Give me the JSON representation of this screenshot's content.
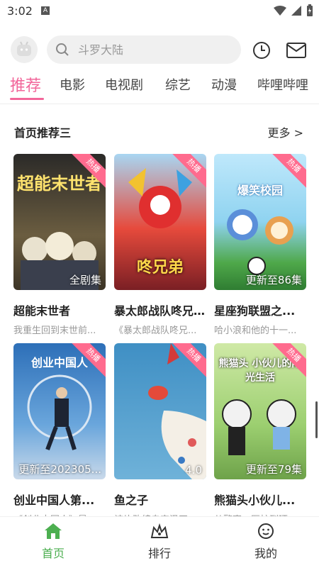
{
  "status": {
    "time": "3:02",
    "notif_letter": "A"
  },
  "search": {
    "placeholder": "斗罗大陆"
  },
  "tabs": [
    {
      "label": "推荐",
      "active": true
    },
    {
      "label": "电影"
    },
    {
      "label": "电视剧"
    },
    {
      "label": "综艺"
    },
    {
      "label": "动漫"
    },
    {
      "label": "哔哩哔哩"
    }
  ],
  "section": {
    "title": "首页推荐三",
    "more": "更多 >"
  },
  "cards": [
    {
      "badge": "热播",
      "note": "全剧集",
      "title": "超能末世者",
      "desc": "我重生回到末世前...",
      "poster_text": "超能末世者",
      "poster_color": "#c8a25a"
    },
    {
      "badge": "热播",
      "note": "",
      "title": "暴太郎战队咚兄...",
      "desc": "《暴太郎战队咚兄...",
      "poster_text": "咚兄弟",
      "poster_color": "#d8312b"
    },
    {
      "badge": "热播",
      "note": "更新至86集",
      "title": "星座狗联盟之...",
      "desc": "哈小浪和他的十一...",
      "poster_text": "爆笑校园",
      "poster_color": "#4cb7e6"
    },
    {
      "badge": "热播",
      "note": "更新至202305...",
      "title": "创业中国人第...",
      "desc": "《创业中国人》是...",
      "poster_text": "创业中国人",
      "poster_color": "#3a7fc7"
    },
    {
      "badge": "热播",
      "note": "4.0",
      "title": "鱼之子",
      "desc": "该片改编自宫泽正...",
      "poster_text": "",
      "poster_color": "#5aa0c8"
    },
    {
      "badge": "热播",
      "note": "更新至79集",
      "title": "熊猫头小伙儿...",
      "desc": "从警察、医护到环...",
      "poster_text": "熊猫头 小伙儿的阳光生活",
      "poster_color": "#a7d36a"
    }
  ],
  "nav": [
    {
      "label": "首页",
      "active": true
    },
    {
      "label": "排行"
    },
    {
      "label": "我的"
    }
  ],
  "colors": {
    "accent": "#f2669a",
    "nav_active": "#4caf50",
    "badge": "#ff6b8e"
  }
}
